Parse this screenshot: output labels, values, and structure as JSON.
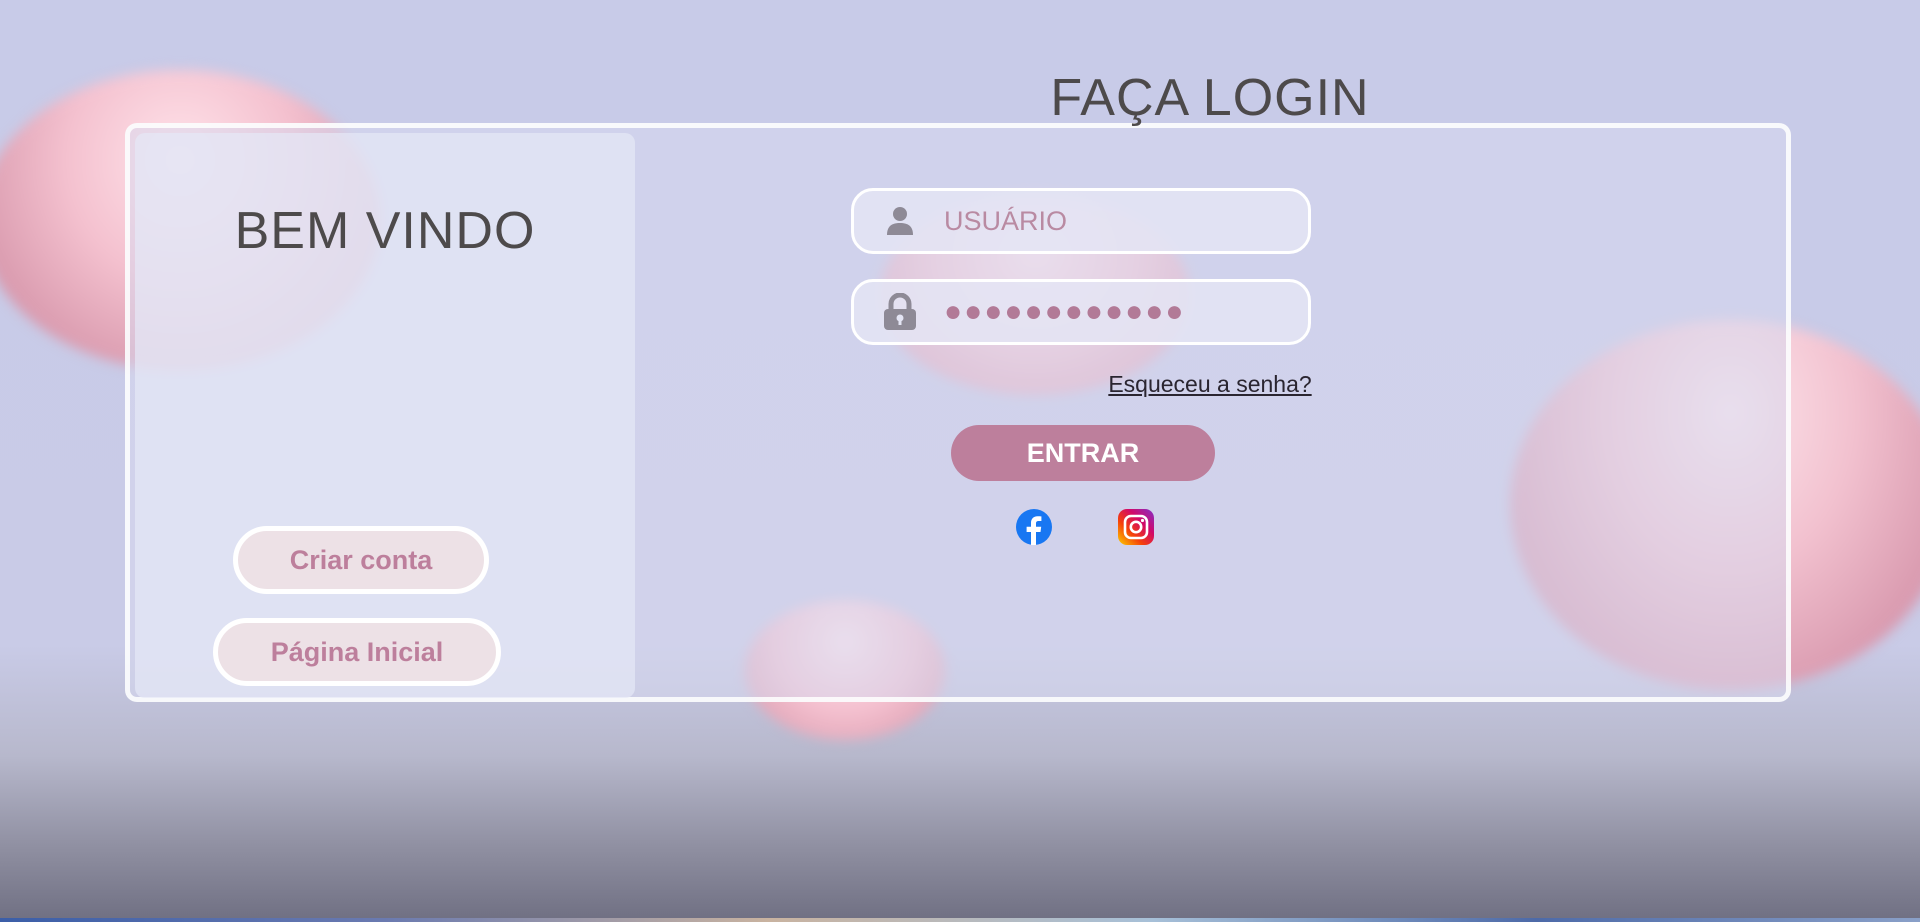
{
  "left_panel": {
    "title": "BEM VINDO",
    "create_account_label": "Criar conta",
    "home_page_label": "Página Inicial"
  },
  "login": {
    "title": "FAÇA LOGIN",
    "username_placeholder": "USUÁRIO",
    "password_value": "●●●●●●●●●●●●",
    "forgot_password_label": "Esqueceu a senha?",
    "enter_label": "ENTRAR"
  },
  "icons": {
    "user": "user-icon",
    "lock": "lock-icon",
    "facebook": "facebook-icon",
    "instagram": "instagram-icon"
  },
  "colors": {
    "accent": "#bd7f9c",
    "title_text": "#4d4a4b",
    "facebook": "#1877f2"
  }
}
